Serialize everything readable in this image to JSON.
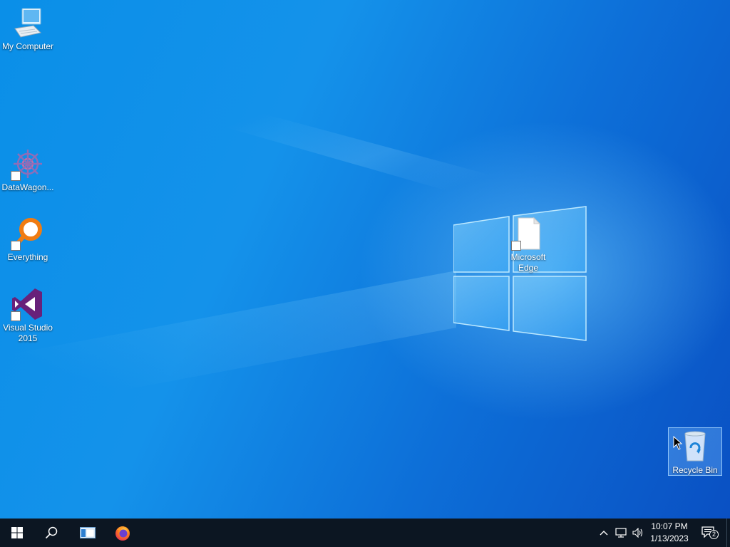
{
  "desktop": {
    "icons": [
      {
        "label": "My Computer",
        "icon": "computer-icon"
      },
      {
        "label": "DataWagon...",
        "icon": "datawagon-icon"
      },
      {
        "label": "Everything",
        "icon": "everything-search-icon"
      },
      {
        "label": "Visual Studio 2015",
        "icon": "visual-studio-icon"
      },
      {
        "label": "Microsoft Edge",
        "icon": "blank-file-icon"
      },
      {
        "label": "Recycle Bin",
        "icon": "recycle-bin-icon"
      }
    ]
  },
  "taskbar": {
    "start_icon": "windows-start-icon",
    "search_icon": "search-icon",
    "pinned": [
      {
        "name": "explorer-window-icon"
      },
      {
        "name": "firefox-icon"
      }
    ],
    "tray": {
      "overflow_icon": "chevron-up-icon",
      "network_icon": "network-icon",
      "volume_icon": "volume-icon",
      "time": "10:07 PM",
      "date": "1/13/2023",
      "notification_count": "2"
    }
  },
  "colors": {
    "taskbar_bg": "#0c1622",
    "desktop_blue": "#0a8fe8",
    "selection": "#78beff"
  }
}
